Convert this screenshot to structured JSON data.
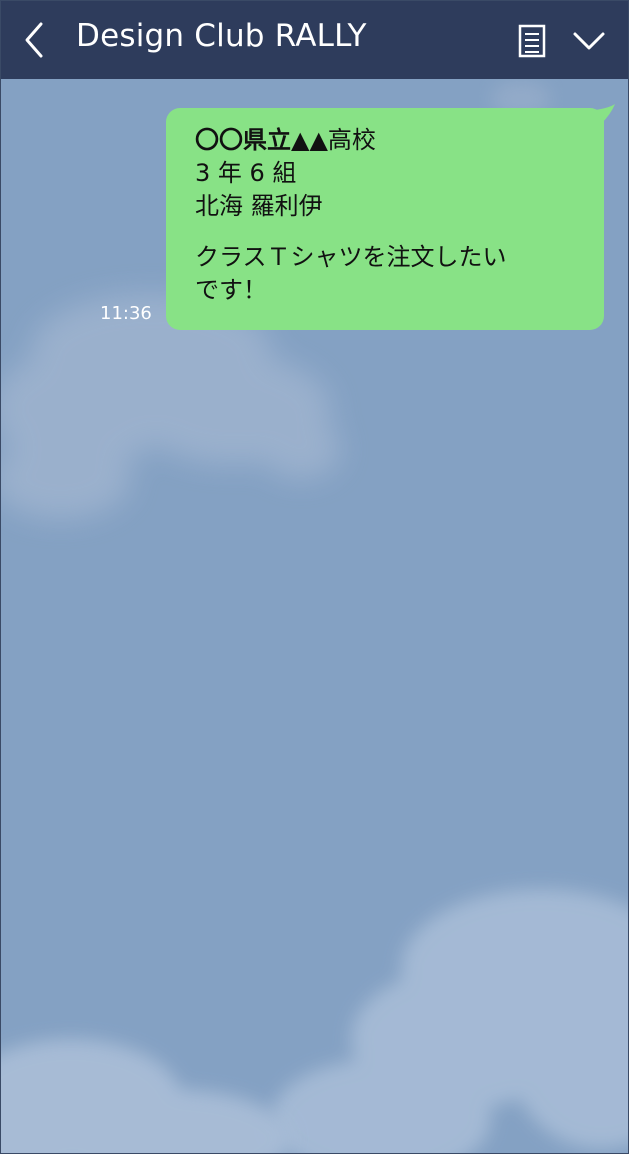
{
  "header": {
    "title": "Design Club RALLY",
    "back_icon": "chevron-left-icon",
    "notes_icon": "notes-icon",
    "menu_icon": "chevron-down-icon",
    "background_color": "#2e3c5c"
  },
  "chat": {
    "background_color": "#84a1c3",
    "messages": [
      {
        "timestamp": "11:36",
        "bubble_color": "#88e286",
        "school_prefix": "〇〇県立▲▲",
        "school_suffix": "高校",
        "class": "3 年 6 組",
        "name": "北海 羅利伊",
        "body_line1": "クラスＴシャツを注文したい",
        "body_line2": "です！"
      }
    ]
  }
}
